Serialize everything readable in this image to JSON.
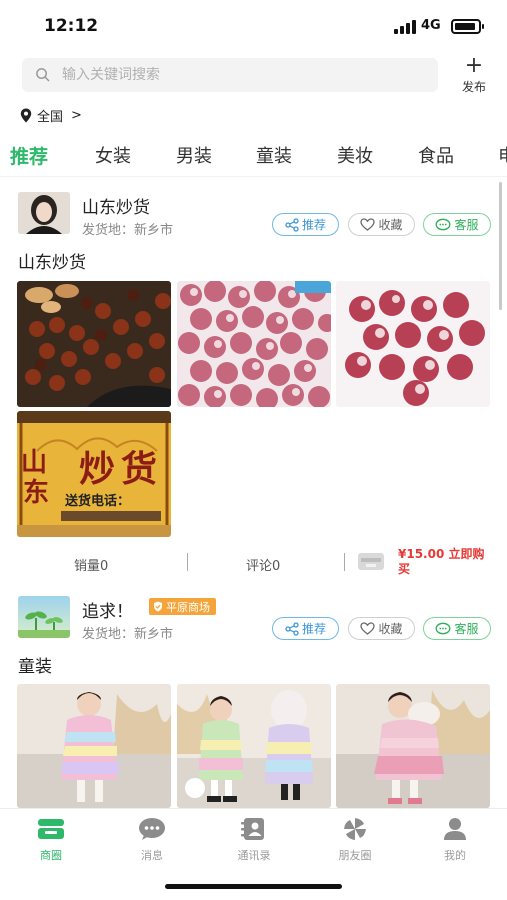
{
  "status_bar": {
    "time": "12:12",
    "network": "4G"
  },
  "search": {
    "placeholder": "输入关键词搜索"
  },
  "publish": {
    "label": "发布"
  },
  "region": {
    "label": "全国"
  },
  "categories": [
    {
      "label": "推荐",
      "active": true
    },
    {
      "label": "女装",
      "active": false
    },
    {
      "label": "男装",
      "active": false
    },
    {
      "label": "童装",
      "active": false
    },
    {
      "label": "美妆",
      "active": false
    },
    {
      "label": "食品",
      "active": false
    },
    {
      "label": "电",
      "active": false
    }
  ],
  "posts": [
    {
      "author": "山东炒货",
      "ship_from": "发货地：新乡市",
      "actions": {
        "recommend": "推荐",
        "favorite": "收藏",
        "service": "客服"
      },
      "title": "山东炒货",
      "photos": [
        "chestnuts",
        "red-dates-1",
        "red-dates-2",
        "stall-sign"
      ],
      "stats": {
        "sales": "销量0",
        "comments": "评论0",
        "price_buy": "¥15.00 立即购买"
      }
    },
    {
      "author": "追求！",
      "badge": "平原商场",
      "ship_from": "发货地：新乡市",
      "actions": {
        "recommend": "推荐",
        "favorite": "收藏",
        "service": "客服"
      },
      "title": "童装",
      "photos": [
        "kids-coat-1",
        "kids-coat-2",
        "kids-coat-3"
      ]
    }
  ],
  "bottom_nav": [
    {
      "label": "商圈",
      "icon": "market-icon",
      "active": true
    },
    {
      "label": "消息",
      "icon": "message-icon",
      "active": false
    },
    {
      "label": "通讯录",
      "icon": "contacts-icon",
      "active": false
    },
    {
      "label": "朋友圈",
      "icon": "moments-icon",
      "active": false
    },
    {
      "label": "我的",
      "icon": "profile-icon",
      "active": false
    }
  ],
  "colors": {
    "accent": "#2eb869",
    "price": "#e53935",
    "badge": "#f3a53b"
  }
}
